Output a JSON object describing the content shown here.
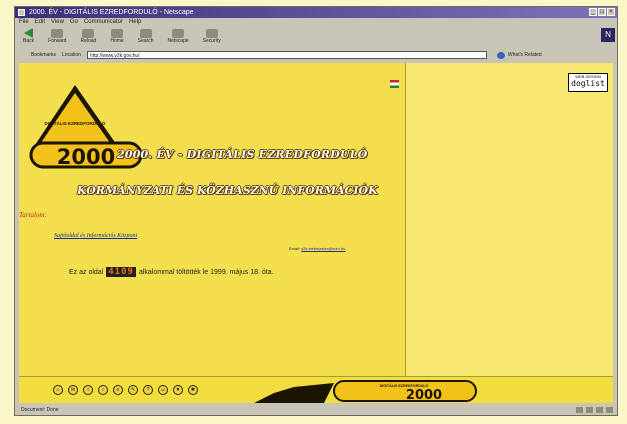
{
  "window": {
    "title": "2000. ÉV - DIGITÁLIS EZREDFORDULÓ - Netscape",
    "controls": [
      "_",
      "□",
      "×"
    ]
  },
  "menu": [
    "File",
    "Edit",
    "View",
    "Go",
    "Communicator",
    "Help"
  ],
  "navigation": {
    "buttons": [
      "Back",
      "Forward",
      "Reload",
      "Home",
      "Search",
      "Netscape",
      "Security"
    ]
  },
  "location": {
    "bookmarks_label": "Bookmarks",
    "location_label": "Location",
    "url": "http://www.y2k.gov.hu/",
    "related_label": "What's Related"
  },
  "page": {
    "logo": {
      "top_text": "DIGITÁLIS EZREDFORDULÓ",
      "number": "2000"
    },
    "title": "2000. ÉV - DIGITÁLIS EZREDFORDULÓ",
    "subtitle": "KORMÁNYZATI ÉS KÖZHASZNÚ INFORMÁCIÓK",
    "contents_label": "Tartalom:",
    "link": "Sajtóoldal és Információs Központ",
    "email_label": "Email:",
    "email_address": "y2k.webmaster@kum.hu",
    "visits_before": "Ez az oldal",
    "counter": "4109",
    "visits_after": "alkalommal töltötték le 1999. május 18. óta.",
    "webdesign_small": "WEB DESIGN",
    "webdesign_big": "doglist"
  },
  "bottom_frame": {
    "icons": [
      "home-icon",
      "mail-icon",
      "info-icon",
      "search-icon",
      "news-icon",
      "edit-icon",
      "help-icon",
      "chat-icon",
      "download-icon",
      "settings-icon"
    ],
    "banner_text": "DIGITÁLIS EZREDFORDULÓ",
    "banner_number": "2000"
  },
  "status": {
    "text": "Document: Done"
  },
  "colors": {
    "page_bg": "#f3df4e",
    "title_outline": "#5b3a00",
    "counter_digits": "#e86c1a"
  }
}
